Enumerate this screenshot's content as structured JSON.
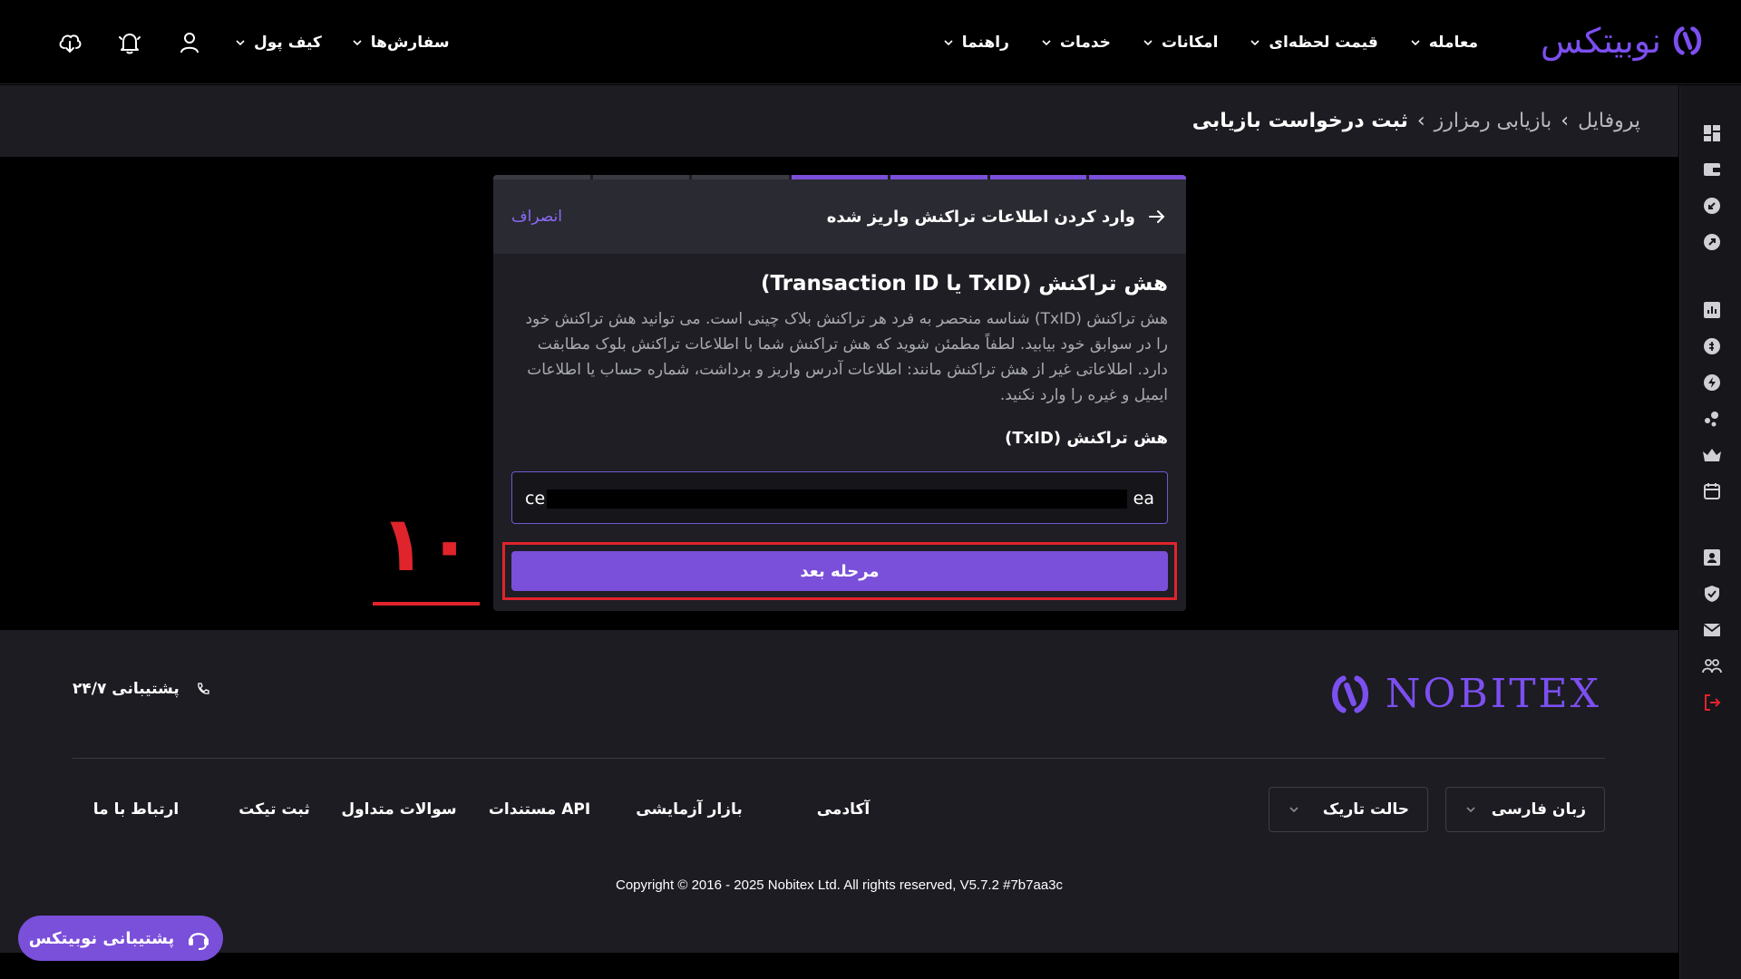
{
  "brand": {
    "name": "نوبیتکس",
    "footer_name": "NOBITEX",
    "color": "#7c4ff0"
  },
  "nav": {
    "items": [
      {
        "label": "معامله",
        "icon": "chevron-down-icon"
      },
      {
        "label": "قیمت لحظه‌ای",
        "icon": "chevron-down-icon"
      },
      {
        "label": "امکانات",
        "icon": "chevron-down-icon"
      },
      {
        "label": "خدمات",
        "icon": "chevron-down-icon"
      },
      {
        "label": "راهنما",
        "icon": "chevron-down-icon"
      }
    ],
    "orders_label": "سفارش‌ها",
    "wallet_label": "کیف پول"
  },
  "sidebar": {
    "icons": [
      "dashboard-icon",
      "wallet-icon",
      "deposit-icon",
      "withdraw-icon",
      "chart-icon",
      "coins-icon",
      "lightning-icon",
      "share-icon",
      "crown-icon",
      "calendar-icon",
      "profile-icon",
      "shield-icon",
      "mail-icon",
      "users-icon",
      "logout-icon"
    ]
  },
  "breadcrumb": {
    "items": [
      "پروفایل",
      "بازیابی رمزارز",
      "ثبت درخواست بازیابی"
    ]
  },
  "dialog": {
    "title": "وارد کردن اطلاعات تراکنش واریز شده",
    "cancel": "انصراف",
    "steps_total": 7,
    "steps_done": 4,
    "heading": "هش تراکنش (TxID یا Transaction ID)",
    "description": "هش تراکنش (TxID) شناسه منحصر به فرد هر تراکنش بلاک چینی است. می توانید هش تراکنش خود را در سوابق خود بیابید. لطفاً مطمئن شوید که هش تراکنش شما با اطلاعات تراکنش بلوک مطابقت دارد. اطلاعاتی غیر از هش تراکنش مانند: اطلاعات آدرس واریز و برداشت، شماره حساب یا اطلاعات ایمیل و غیره را وارد نکنید.",
    "field_label": "هش تراکنش (TxID)",
    "input_start": "ce",
    "input_end": "ea",
    "next_button": "مرحله بعد"
  },
  "annotation": {
    "number": "۱۰"
  },
  "footer": {
    "support": "پشتیبانی ۲۴/۷",
    "language": "زبان فارسی",
    "theme": "حالت تاریک",
    "links": [
      "آکادمی",
      "بازار آزمایشی",
      "مستندات API",
      "سوالات متداول",
      "ثبت تیکت",
      "ارتباط با ما"
    ],
    "copyright": "Copyright © 2016 - 2025 Nobitex Ltd. All rights reserved, V5.7.2 #7b7aa3c"
  },
  "float_support": {
    "label": "پشتیبانی نوبیتکس"
  },
  "colors": {
    "accent": "#7a4fd9",
    "highlight": "#e0242b",
    "step_done": "#7a4fd9",
    "step_todo": "#3a3a42"
  }
}
